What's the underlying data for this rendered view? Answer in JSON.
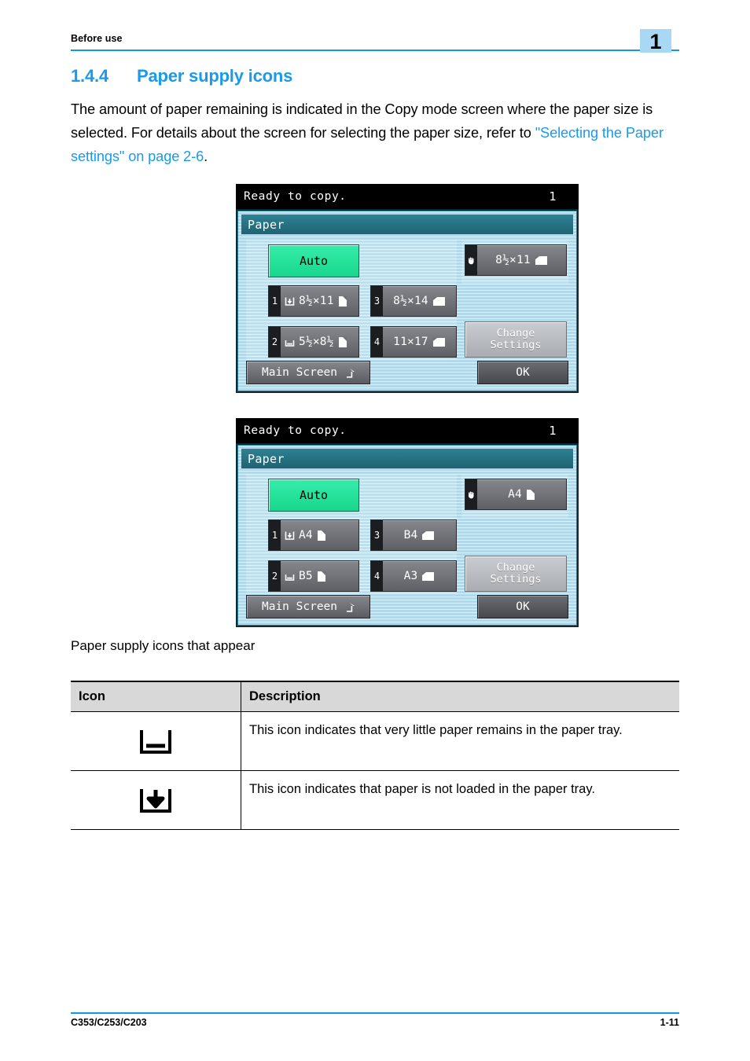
{
  "header": {
    "running_head": "Before use",
    "chapter_number": "1",
    "rule_color": "#0d9ae8",
    "badge_color": "#a9d8f5"
  },
  "heading": {
    "number": "1.4.4",
    "title": "Paper supply icons",
    "color": "#1a9ae8"
  },
  "intro": {
    "text_before": "The amount of paper remaining is indicated in the Copy mode screen where the paper size is selected. For details about the screen for selecting the paper size, refer to ",
    "link_text": "\"Selecting the Paper settings\" on page 2-6",
    "text_after": "."
  },
  "caption": "Paper supply icons that appear",
  "lcd_screens": [
    {
      "id": "inch-sizes",
      "status_text": "Ready to copy.",
      "copy_count": "1",
      "panel_title": "Paper",
      "auto_label": "Auto",
      "bypass": {
        "icon": "hand-icon",
        "label": "8½×11",
        "orientation": "landscape"
      },
      "trays": [
        {
          "number": "1",
          "supply_icon": "paper-empty-icon",
          "label": "8½×11",
          "orientation": "portrait"
        },
        {
          "number": "2",
          "supply_icon": "paper-low-icon",
          "label": "5½×8½",
          "orientation": "portrait"
        },
        {
          "number": "3",
          "supply_icon": "none",
          "label": "8½×14",
          "orientation": "landscape"
        },
        {
          "number": "4",
          "supply_icon": "none",
          "label": "11×17",
          "orientation": "landscape"
        }
      ],
      "change_settings_line1": "Change",
      "change_settings_line2": "Settings",
      "main_screen_label": "Main Screen",
      "ok_label": "OK"
    },
    {
      "id": "metric-sizes",
      "status_text": "Ready to copy.",
      "copy_count": "1",
      "panel_title": "Paper",
      "auto_label": "Auto",
      "bypass": {
        "icon": "hand-icon",
        "label": "A4",
        "orientation": "portrait"
      },
      "trays": [
        {
          "number": "1",
          "supply_icon": "paper-empty-icon",
          "label": "A4",
          "orientation": "portrait"
        },
        {
          "number": "2",
          "supply_icon": "paper-low-icon",
          "label": "B5",
          "orientation": "portrait"
        },
        {
          "number": "3",
          "supply_icon": "none",
          "label": "B4",
          "orientation": "landscape"
        },
        {
          "number": "4",
          "supply_icon": "none",
          "label": "A3",
          "orientation": "landscape"
        }
      ],
      "change_settings_line1": "Change",
      "change_settings_line2": "Settings",
      "main_screen_label": "Main Screen",
      "ok_label": "OK"
    }
  ],
  "table": {
    "columns": [
      "Icon",
      "Description"
    ],
    "rows": [
      {
        "icon": "paper-low-icon",
        "description": "This icon indicates that very little paper remains in the paper tray."
      },
      {
        "icon": "paper-empty-icon",
        "description": "This icon indicates that paper is not loaded in the paper tray."
      }
    ]
  },
  "footer": {
    "models": "C353/C253/C203",
    "page_number": "1-11"
  }
}
